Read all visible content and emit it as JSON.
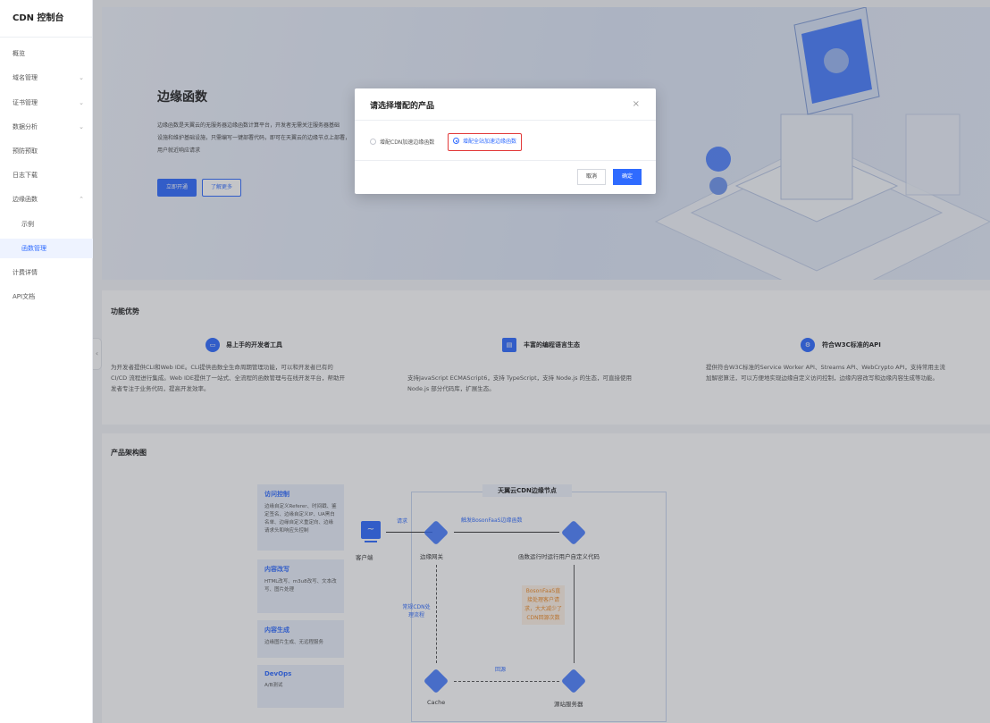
{
  "sidebar": {
    "title": "CDN 控制台",
    "items": [
      {
        "label": "概览",
        "chevron": false
      },
      {
        "label": "域名管理",
        "chevron": true
      },
      {
        "label": "证书管理",
        "chevron": true
      },
      {
        "label": "数据分析",
        "chevron": true
      },
      {
        "label": "预防预取",
        "chevron": false
      },
      {
        "label": "日志下载",
        "chevron": false
      },
      {
        "label": "边缘函数",
        "chevron": true,
        "expanded": true
      },
      {
        "label": "示例",
        "sub": true
      },
      {
        "label": "函数管理",
        "sub": true,
        "active": true
      },
      {
        "label": "计费详情",
        "chevron": false
      },
      {
        "label": "API文档",
        "chevron": false
      }
    ],
    "collapse_glyph": "‹",
    "chev_down": "⌄",
    "chev_up": "⌃"
  },
  "hero": {
    "title": "边缘函数",
    "desc_lines": [
      "边缘函数是天翼云的无服务器边缘函数计算平台，开发者无需关注服务器基础",
      "设施和维护基础设施，只需编写一键部署代码，即可在天翼云的边缘节点上部署，",
      "用户就近响应请求"
    ],
    "btn_primary": "立即开通",
    "btn_secondary": "了解更多"
  },
  "modal": {
    "title": "请选择增配的产品",
    "close": "×",
    "option1": "增配CDN加速边缘函数",
    "option2": "增配全站加速边缘函数",
    "cancel": "取消",
    "ok": "确定"
  },
  "advantages": {
    "title": "功能优势",
    "items": [
      {
        "icon": "▭",
        "title": "易上手的开发者工具",
        "desc_lines": [
          "为开发者提供CLI和Web IDE。CLI提供函数全生命周期管理功能，可以和开发者已有的",
          "CI/CD 流程进行集成。Web IDE提供了一站式、全流程的函数管理与在线开发平台，帮助开",
          "发者专注于业务代码，提高开发效率。"
        ]
      },
      {
        "icon": "▤",
        "title": "丰富的编程语言生态",
        "desc_lines": [
          "支持JavaScript ECMAScript6，支持 TypeScript，支持 Node.js 的生态，可直接使用",
          "Node.js 部分代码库，扩展生态。"
        ]
      },
      {
        "icon": "⚙",
        "title": "符合W3C标准的API",
        "desc_lines": [
          "提供符合W3C标准的Service Worker API、Streams API、WebCrypto API，支持常用主流",
          "加解密算法，可以方便地实现边缘自定义访问控制，边缘内容改写和边缘内容生成等功能。"
        ]
      }
    ]
  },
  "arch": {
    "title": "产品架构图",
    "cards": [
      {
        "title": "访问控制",
        "desc": "边缘自定义Referer、时间戳、鉴定签名、边缘自定义IP、UA黑白名单、边缘自定义重定向、边缘请求头和响应头控制"
      },
      {
        "title": "内容改写",
        "desc": "HTML改写、m3u8改写、文本改写、图片处理"
      },
      {
        "title": "内容生成",
        "desc": "边缘图片生成、无远程服务"
      },
      {
        "title": "DevOps",
        "desc": "A/B测试"
      }
    ],
    "edge_title": "天翼云CDN边缘节点",
    "client": "客户端",
    "request": "请求",
    "edge_gateway": "边缘网关",
    "trigger": "触发BosonFaaS边缘函数",
    "runtime": "函数运行时运行用户自定义代码",
    "normal_cdn": "常规CDN处理流程",
    "bosonfaas_note": "BosonFaaS直接处理客户请求，大大减少了CDN回源次数",
    "back_to_origin": "回源",
    "cache": "Cache",
    "origin": "源站服务器"
  }
}
